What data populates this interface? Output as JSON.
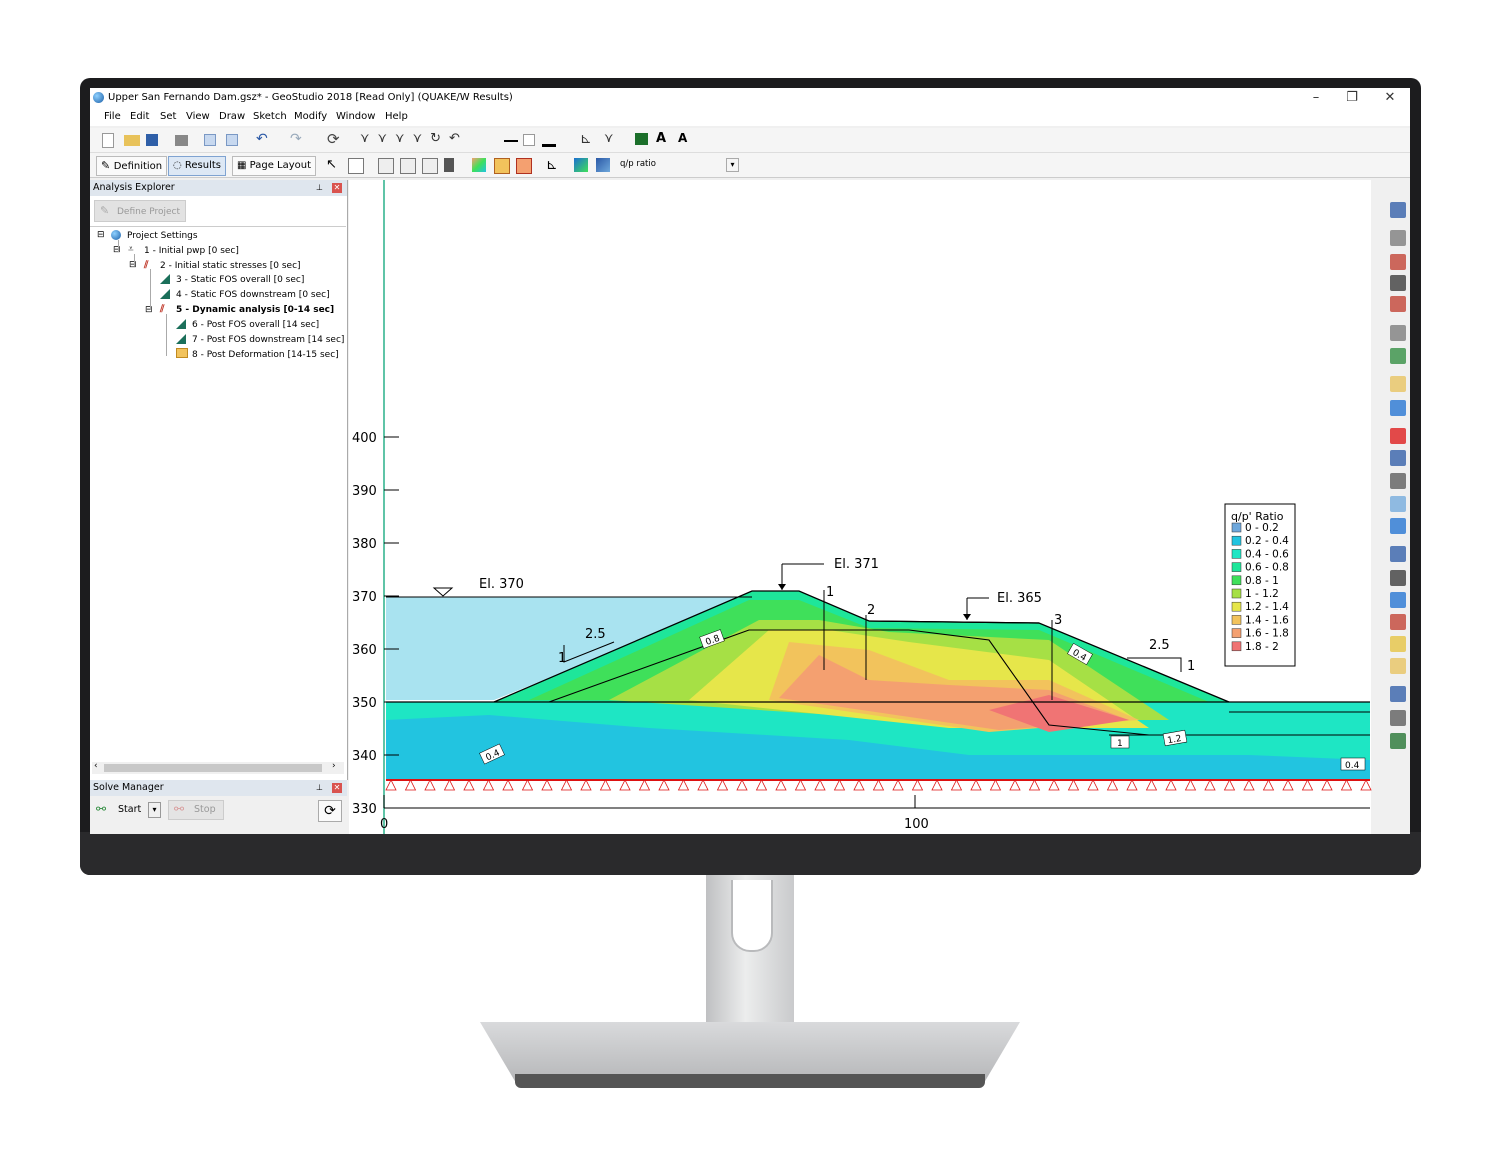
{
  "window": {
    "title": "Upper San Fernando Dam.gsz* - GeoStudio 2018 [Read Only] (QUAKE/W Results)",
    "min_label": "–",
    "max_label": "❐",
    "close_label": "✕"
  },
  "menu": [
    "File",
    "Edit",
    "Set",
    "View",
    "Draw",
    "Sketch",
    "Modify",
    "Window",
    "Help"
  ],
  "toolbar": {
    "definition_label": "Definition",
    "results_label": "Results",
    "page_layout_label": "Page Layout",
    "contour_select": "q/p ratio"
  },
  "explorer": {
    "title": "Analysis Explorer",
    "define_project_label": "Define Project",
    "tree": [
      "Project Settings",
      "1 - Initial pwp [0 sec]",
      "2 - Initial static stresses [0 sec]",
      "3 - Static FOS overall [0 sec]",
      "4 - Static FOS downstream  [0 sec]",
      "5 - Dynamic analysis [0-14 sec]",
      "6 - Post FOS overall [14 sec]",
      "7 - Post FOS downstream [14 sec]",
      "8 - Post Deformation [14-15 sec]"
    ]
  },
  "solve_manager": {
    "title": "Solve Manager",
    "start_label": "Start",
    "stop_label": "Stop"
  },
  "chart_data": {
    "type": "contour",
    "y_ticks": [
      400,
      390,
      380,
      370,
      360,
      350,
      340,
      330
    ],
    "x_ticks": [
      0,
      100
    ],
    "ylim": [
      330,
      400
    ],
    "annotations": {
      "el_370": "El. 370",
      "el_371": "El. 371",
      "el_365": "El. 365",
      "slope_up_h": "2.5",
      "slope_up_v": "1",
      "slope_down_h": "2.5",
      "slope_down_v": "1",
      "slip_1": "1",
      "slip_2": "2",
      "slip_3": "3"
    },
    "contour_labels": [
      "0.8",
      "0.4",
      "0.4",
      "1",
      "1.2",
      "0.4"
    ],
    "legend": {
      "title": "q/p' Ratio",
      "items": [
        {
          "label": "0 - 0.2",
          "color": "#6fa8dc"
        },
        {
          "label": "0.2 - 0.4",
          "color": "#22c4e0"
        },
        {
          "label": "0.4 - 0.6",
          "color": "#1ee6c4"
        },
        {
          "label": "0.6 - 0.8",
          "color": "#1ee69a"
        },
        {
          "label": "0.8 - 1",
          "color": "#3fe05a"
        },
        {
          "label": "1 - 1.2",
          "color": "#a6e045"
        },
        {
          "label": "1.2 - 1.4",
          "color": "#e6e64a"
        },
        {
          "label": "1.4 - 1.6",
          "color": "#f2c35c"
        },
        {
          "label": "1.6 - 1.8",
          "color": "#f4a070"
        },
        {
          "label": "1.8 - 2",
          "color": "#f07474"
        }
      ]
    }
  }
}
